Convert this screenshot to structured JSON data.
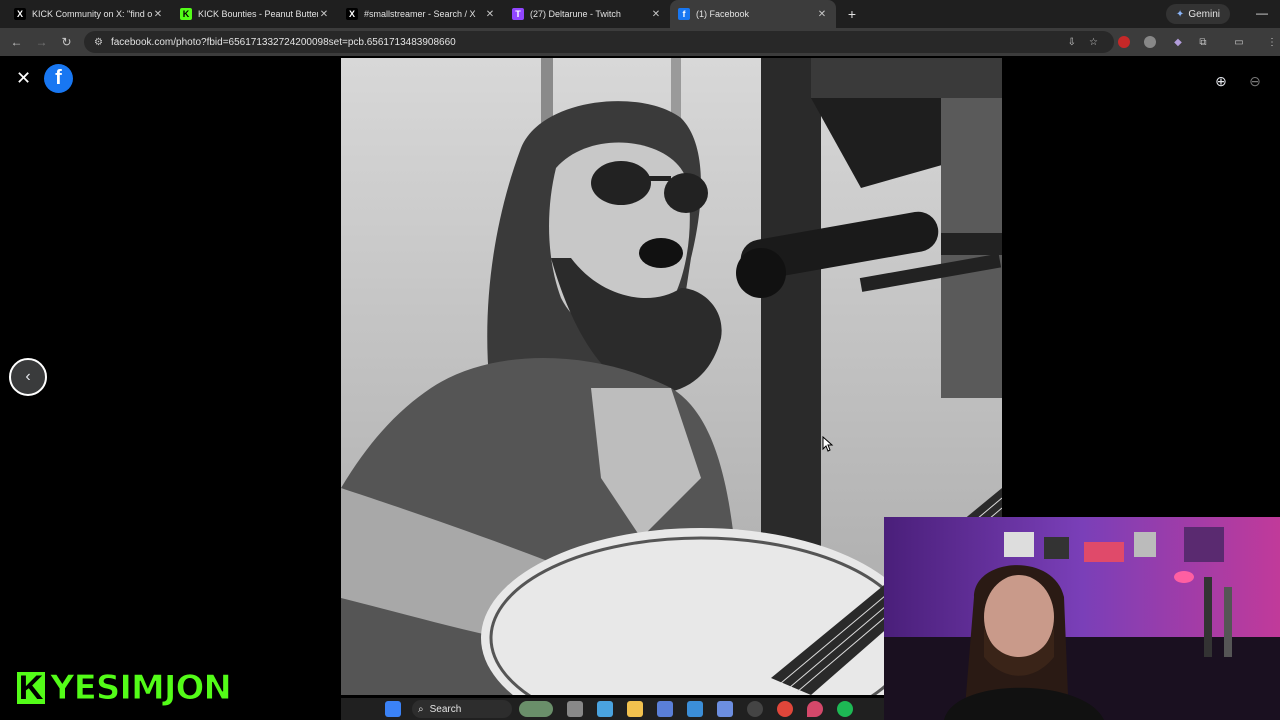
{
  "browser": {
    "tabs": [
      {
        "title": "KICK Community on X: \"find ou",
        "favicon": "x-icon",
        "fav_color": "#000000",
        "fav_glyph": "X"
      },
      {
        "title": "KICK Bounties - Peanut Butter V",
        "favicon": "kick-icon",
        "fav_color": "#53fc18",
        "fav_glyph": "K"
      },
      {
        "title": "#smallstreamer - Search / X",
        "favicon": "x-icon",
        "fav_color": "#000000",
        "fav_glyph": "X"
      },
      {
        "title": "(27) Deltarune - Twitch",
        "favicon": "twitch-icon",
        "fav_color": "#9146ff",
        "fav_glyph": "T"
      },
      {
        "title": "(1) Facebook",
        "favicon": "facebook-icon",
        "fav_color": "#1877f2",
        "fav_glyph": "f",
        "active": true
      }
    ],
    "new_tab": "+",
    "gemini_label": "Gemini",
    "minimize": "—",
    "url": "facebook.com/photo?fbid=656171332724200098set=pcb.6561713483908660"
  },
  "viewer": {
    "close": "✕",
    "fb_glyph": "f",
    "prev": "‹",
    "zoom_in": "⊕",
    "zoom_out": "⊖"
  },
  "overlay": {
    "kick_k": "K",
    "kick_name": "YESIMJON"
  },
  "taskbar": {
    "search_label": "Search"
  },
  "colors": {
    "facebook_blue": "#1877f2",
    "kick_green": "#53fc18"
  }
}
